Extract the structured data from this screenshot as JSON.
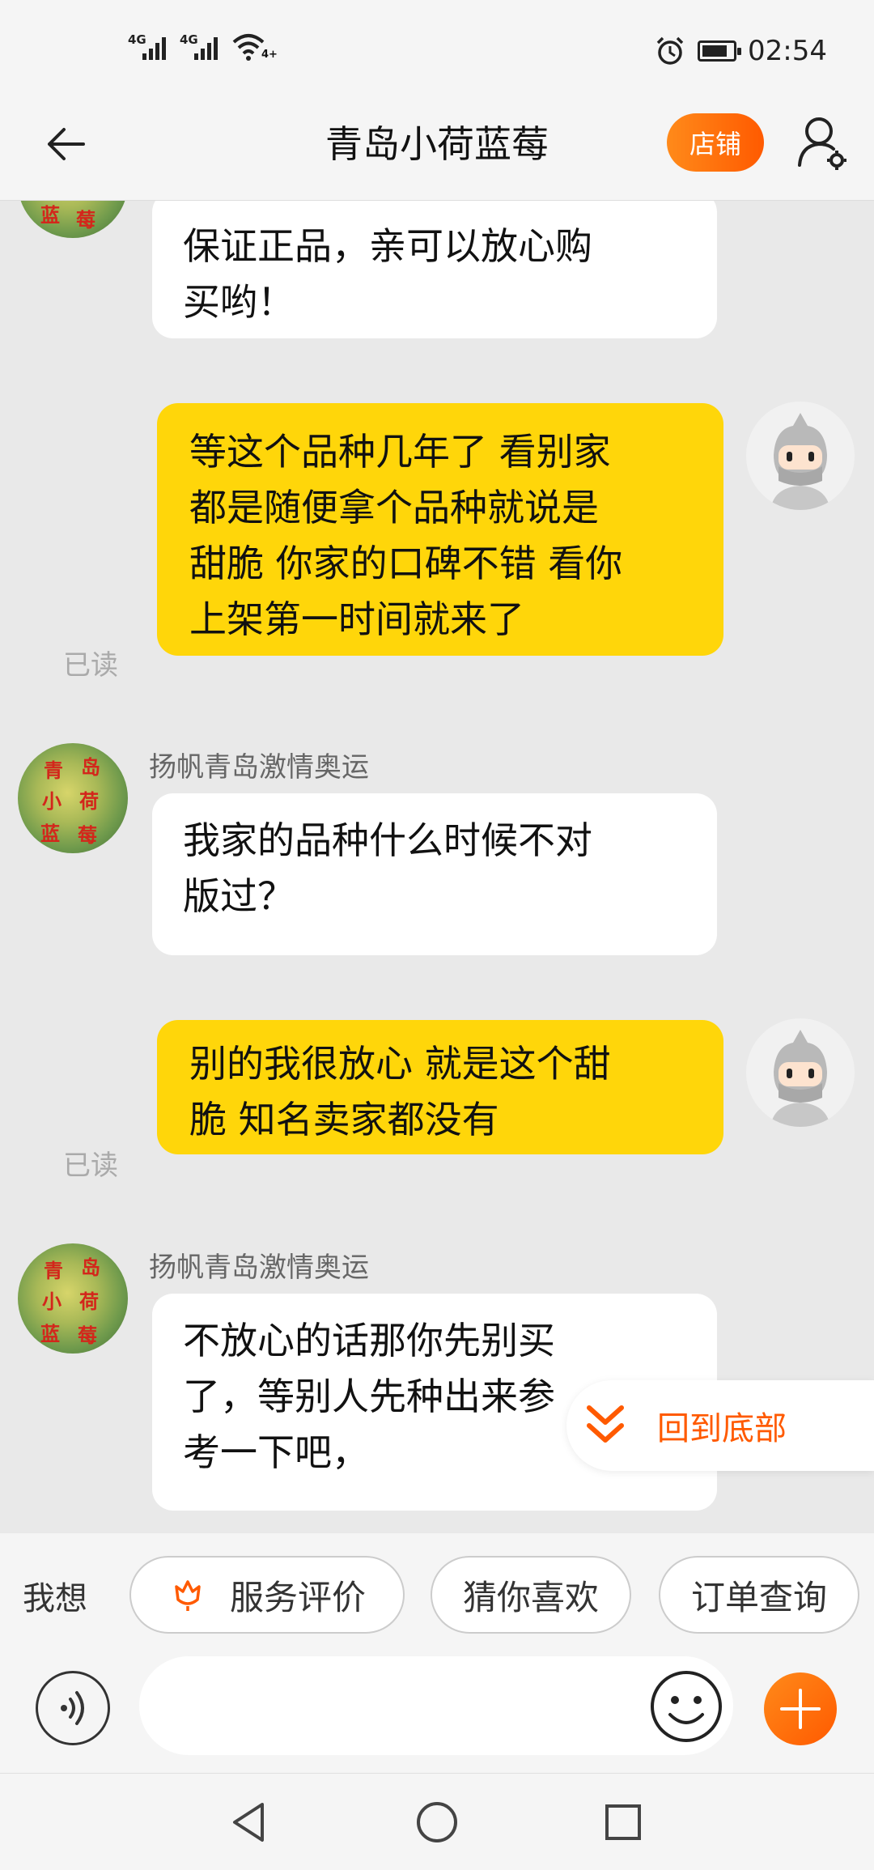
{
  "status_bar": {
    "network_1": "4G",
    "network_2": "4G",
    "wifi_tag": "4+",
    "time": "02:54"
  },
  "header": {
    "title": "青岛小荷蓝莓",
    "shop_button": "店铺"
  },
  "shop_avatar_text": [
    "青",
    "岛",
    "小",
    "荷",
    "蓝",
    "莓"
  ],
  "messages": [
    {
      "side": "in",
      "sender": "",
      "text": "保证正品，亲可以放心购\n买哟！"
    },
    {
      "side": "out",
      "read": "已读",
      "text": "等这个品种几年了 看别家\n都是随便拿个品种就说是\n甜脆 你家的口碑不错 看你\n上架第一时间就来了"
    },
    {
      "side": "in",
      "sender": "扬帆青岛激情奥运",
      "text": "我家的品种什么时候不对\n版过？"
    },
    {
      "side": "out",
      "read": "已读",
      "text": "别的我很放心 就是这个甜\n脆 知名卖家都没有"
    },
    {
      "side": "in",
      "sender": "扬帆青岛激情奥运",
      "text": "不放心的话那你先别买\n了，等别人先种出来参\n考一下吧，"
    }
  ],
  "back_to_bottom": "回到底部",
  "quick_actions": {
    "label": "我想",
    "items": [
      "服务评价",
      "猜你喜欢",
      "订单查询"
    ]
  },
  "input": {
    "placeholder": ""
  },
  "colors": {
    "accent": "#ff5a00",
    "outgoing_bubble": "#ffd60a",
    "incoming_bubble": "#ffffff",
    "background": "#e9e9e9"
  },
  "icons": [
    "back-arrow-icon",
    "user-settings-icon",
    "voice-icon",
    "emoji-icon",
    "plus-icon",
    "double-chevron-down-icon",
    "flower-icon",
    "nav-back-icon",
    "nav-home-icon",
    "nav-recents-icon"
  ]
}
